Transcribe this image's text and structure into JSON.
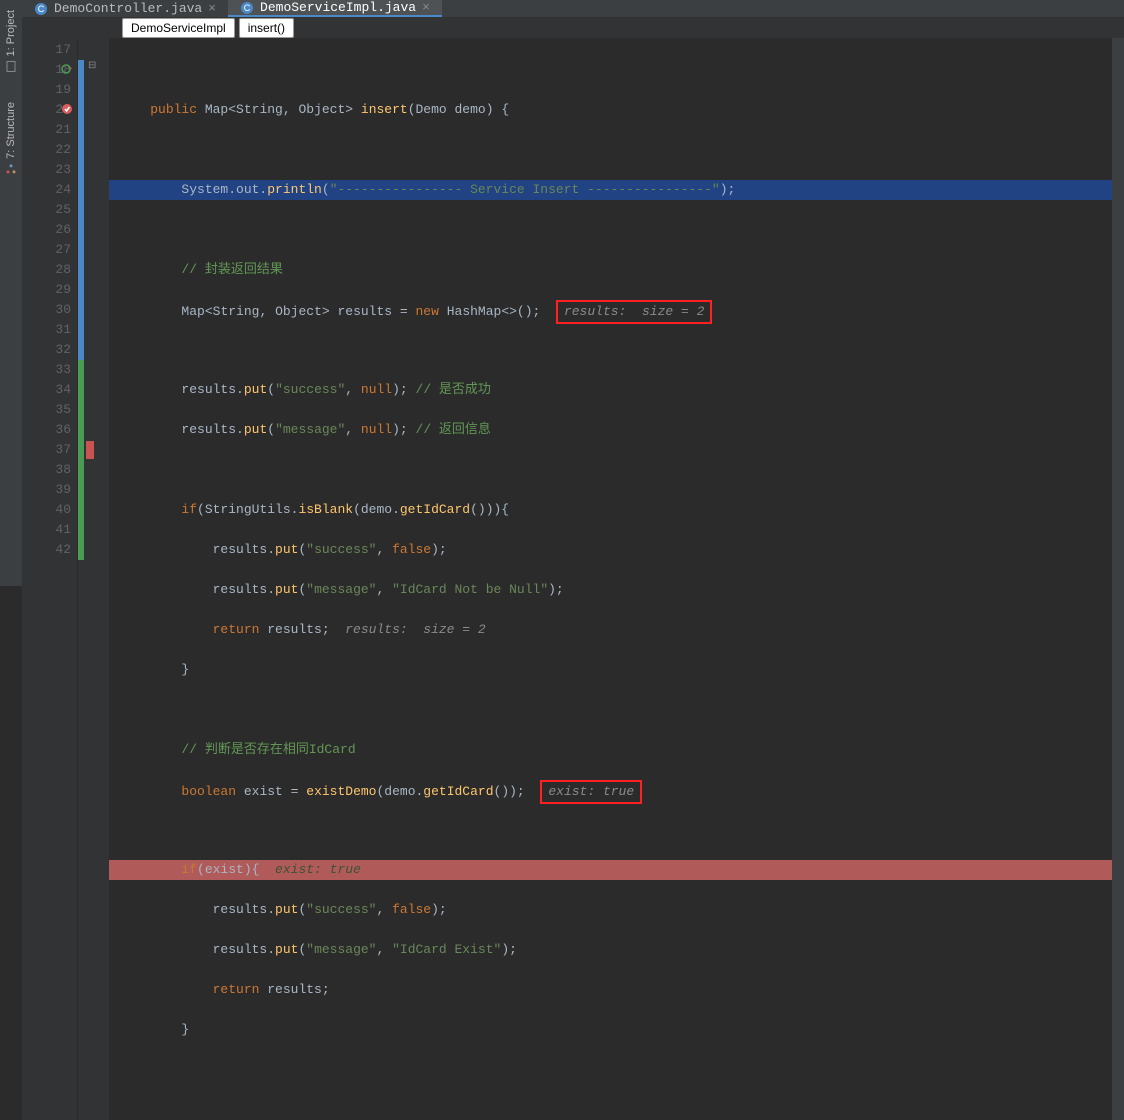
{
  "sidebar": {
    "items": [
      {
        "label": "1: Project",
        "icon": "project"
      },
      {
        "label": "7: Structure",
        "icon": "structure"
      }
    ]
  },
  "tabs": [
    {
      "label": "DemoController.java",
      "active": false
    },
    {
      "label": "DemoServiceImpl.java",
      "active": true
    }
  ],
  "breadcrumb": [
    {
      "label": "DemoServiceImpl"
    },
    {
      "label": "insert()"
    }
  ],
  "gutter": {
    "start": 17,
    "end": 42,
    "icons": {
      "18": "override",
      "20": "breakpoint"
    }
  },
  "code": {
    "l17": "",
    "l18": {
      "kw1": "public ",
      "type": "Map",
      "gl": "<",
      "t2": "String",
      "c": ", ",
      "t3": "Object",
      "gr": "> ",
      "fn": "insert",
      "p": "(Demo demo) {"
    },
    "l19": "",
    "l20": {
      "pre": "        System.out.",
      "fn": "println",
      "args": "(",
      "str": "\"---------------- Service Insert ----------------\"",
      "end": ");"
    },
    "l21": "",
    "l22": {
      "cmt": "// 封装返回结果"
    },
    "l23": {
      "t": "Map",
      "gl": "<",
      "t2": "String",
      "c": ", ",
      "t3": "Object",
      "gr": "> results = ",
      "kw": "new ",
      "t4": "HashMap",
      "end": "<>();",
      "inlay": "results:  size = 2"
    },
    "l24": "",
    "l25": {
      "pre": "results.",
      "fn": "put",
      "a": "(",
      "s": "\"success\"",
      "m": ", ",
      "kw": "null",
      "e": "); ",
      "cmt": "// 是否成功"
    },
    "l26": {
      "pre": "results.",
      "fn": "put",
      "a": "(",
      "s": "\"message\"",
      "m": ", ",
      "kw": "null",
      "e": "); ",
      "cmt": "// 返回信息"
    },
    "l27": "",
    "l28": {
      "kw": "if",
      "p": "(StringUtils.",
      "fn": "isBlank",
      "a": "(demo.",
      "fn2": "getIdCard",
      "e": "())){"
    },
    "l29": {
      "pre": "results.",
      "fn": "put",
      "a": "(",
      "s": "\"success\"",
      "m": ", ",
      "kw": "false",
      "e": ");"
    },
    "l30": {
      "pre": "results.",
      "fn": "put",
      "a": "(",
      "s": "\"message\"",
      "m": ", ",
      "s2": "\"IdCard Not be Null\"",
      "e": ");"
    },
    "l31": {
      "kw": "return ",
      "id": "results;",
      "inlay": "  results:  size = 2"
    },
    "l32": {
      "txt": "}"
    },
    "l33": "",
    "l34": {
      "cmt": "// 判断是否存在相同IdCard"
    },
    "l35": {
      "kw": "boolean ",
      "id": "exist = ",
      "fn": "existDemo",
      "a": "(demo.",
      "fn2": "getIdCard",
      "e": "());",
      "inlay": "exist: true"
    },
    "l36": "",
    "l37": {
      "kw": "if",
      "p": "(exist){",
      "inlay": "  exist: true"
    },
    "l38": {
      "pre": "results.",
      "fn": "put",
      "a": "(",
      "s": "\"success\"",
      "m": ", ",
      "kw": "false",
      "e": ");"
    },
    "l39": {
      "pre": "results.",
      "fn": "put",
      "a": "(",
      "s": "\"message\"",
      "m": ", ",
      "s2": "\"IdCard Exist\"",
      "e": ");"
    },
    "l40": {
      "kw": "return ",
      "id": "results;"
    },
    "l41": {
      "txt": "}"
    },
    "l42": ""
  }
}
